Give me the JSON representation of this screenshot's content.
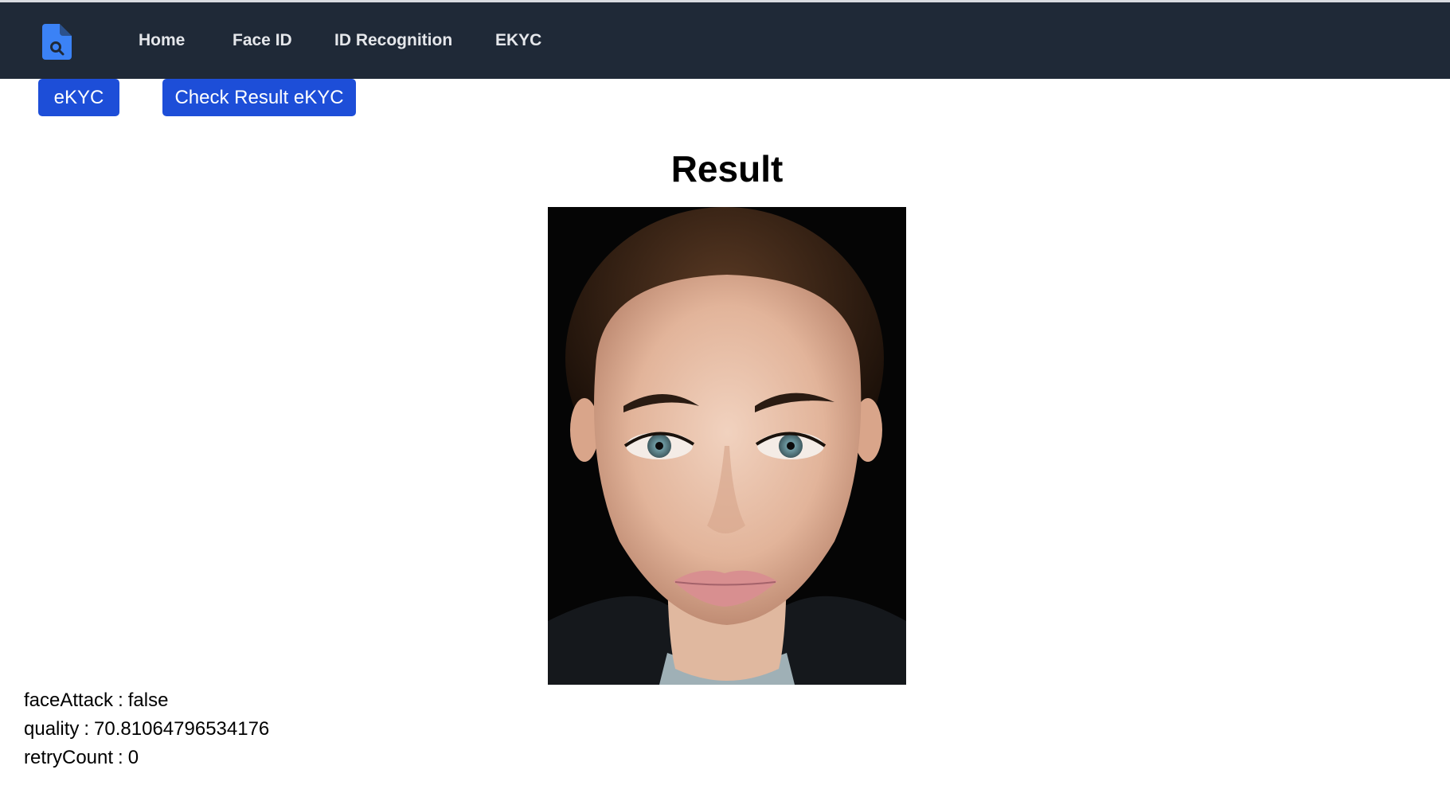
{
  "nav": {
    "logo_icon": "document-search-icon",
    "items": [
      {
        "label": "Home"
      },
      {
        "label": "Face ID"
      },
      {
        "label": "ID Recognition"
      },
      {
        "label": "EKYC"
      }
    ]
  },
  "actions": {
    "ekyc_label": "eKYC",
    "check_label": "Check Result eKYC"
  },
  "result": {
    "title": "Result",
    "fields": [
      {
        "key": "faceAttack",
        "value": "false"
      },
      {
        "key": "quality",
        "value": "70.81064796534176"
      },
      {
        "key": "retryCount",
        "value": "0"
      }
    ]
  },
  "colors": {
    "navbar_bg": "#1f2937",
    "button_bg": "#1d4ed8",
    "logo": "#3b82f6"
  }
}
